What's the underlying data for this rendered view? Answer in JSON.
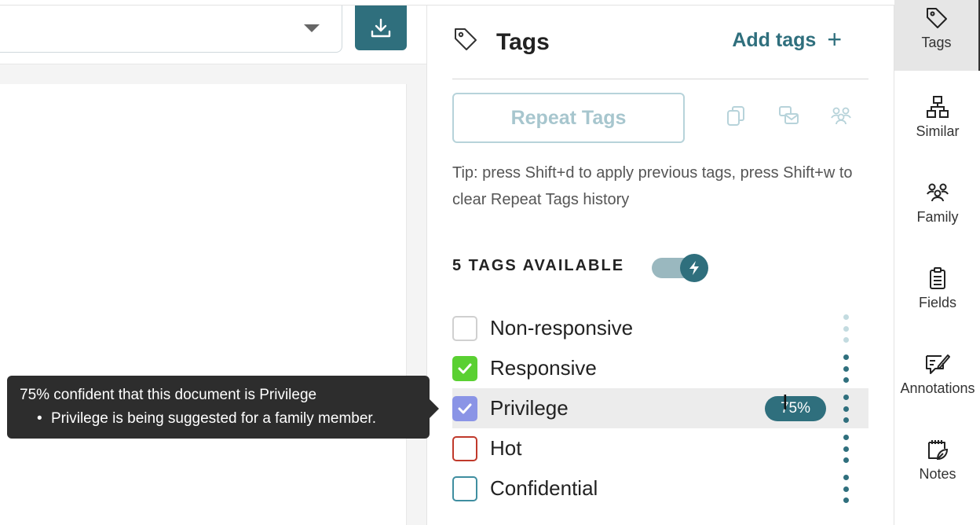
{
  "panel": {
    "title": "Tags",
    "add_tags_label": "Add tags",
    "add_icon": "+",
    "repeat_label": "Repeat Tags",
    "tip": "Tip: press Shift+d to apply previous tags, press Shift+w to clear Repeat Tags history",
    "available_label": "5 TAGS AVAILABLE"
  },
  "tags": [
    {
      "label": "Non-responsive",
      "checked": false
    },
    {
      "label": "Responsive",
      "checked": true
    },
    {
      "label": "Privilege",
      "checked": true,
      "badge": "75%"
    },
    {
      "label": "Hot",
      "checked": false
    },
    {
      "label": "Confidential",
      "checked": false
    }
  ],
  "tooltip": {
    "line1": "75% confident that this document is Privilege",
    "line2": "Privilege is being suggested for a family member."
  },
  "rail": [
    {
      "label": "Tags",
      "icon": "tag-icon"
    },
    {
      "label": "Similar",
      "icon": "hierarchy-icon"
    },
    {
      "label": "Family",
      "icon": "family-icon"
    },
    {
      "label": "Fields",
      "icon": "clipboard-icon"
    },
    {
      "label": "Annotations",
      "icon": "annotation-icon"
    },
    {
      "label": "Notes",
      "icon": "notes-icon"
    }
  ],
  "colors": {
    "accent": "#2f6f7d",
    "responsive_check": "#5ad032",
    "privilege_check": "#8a94e6",
    "hot_border": "#c0392b",
    "confidential_border": "#3f8ea0"
  }
}
